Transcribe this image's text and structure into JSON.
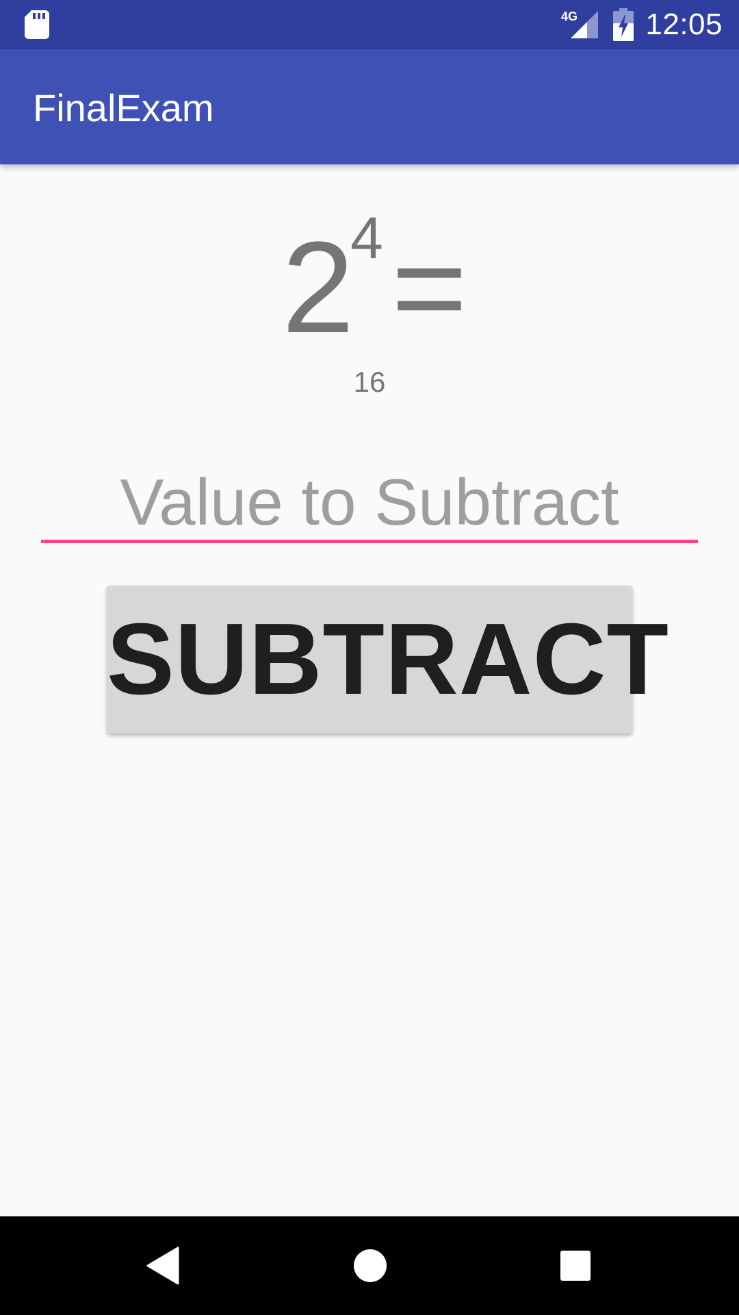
{
  "status_bar": {
    "time": "12:05",
    "network": "4G",
    "icons": [
      "sd-card-icon",
      "signal-icon",
      "battery-charging-icon"
    ]
  },
  "app_bar": {
    "title": "FinalExam"
  },
  "equation": {
    "base": "2",
    "exponent": "4",
    "equals": "=",
    "result": "16"
  },
  "input": {
    "placeholder": "Value to Subtract",
    "value": ""
  },
  "button": {
    "label": "SUBTRACT"
  },
  "nav_bar": {
    "icons": [
      "back-icon",
      "home-icon",
      "recents-icon"
    ]
  },
  "colors": {
    "status_bar": "#303f9f",
    "app_bar": "#3f51b5",
    "accent": "#ff4081",
    "button": "#d6d7d7",
    "text_secondary": "#757575"
  }
}
